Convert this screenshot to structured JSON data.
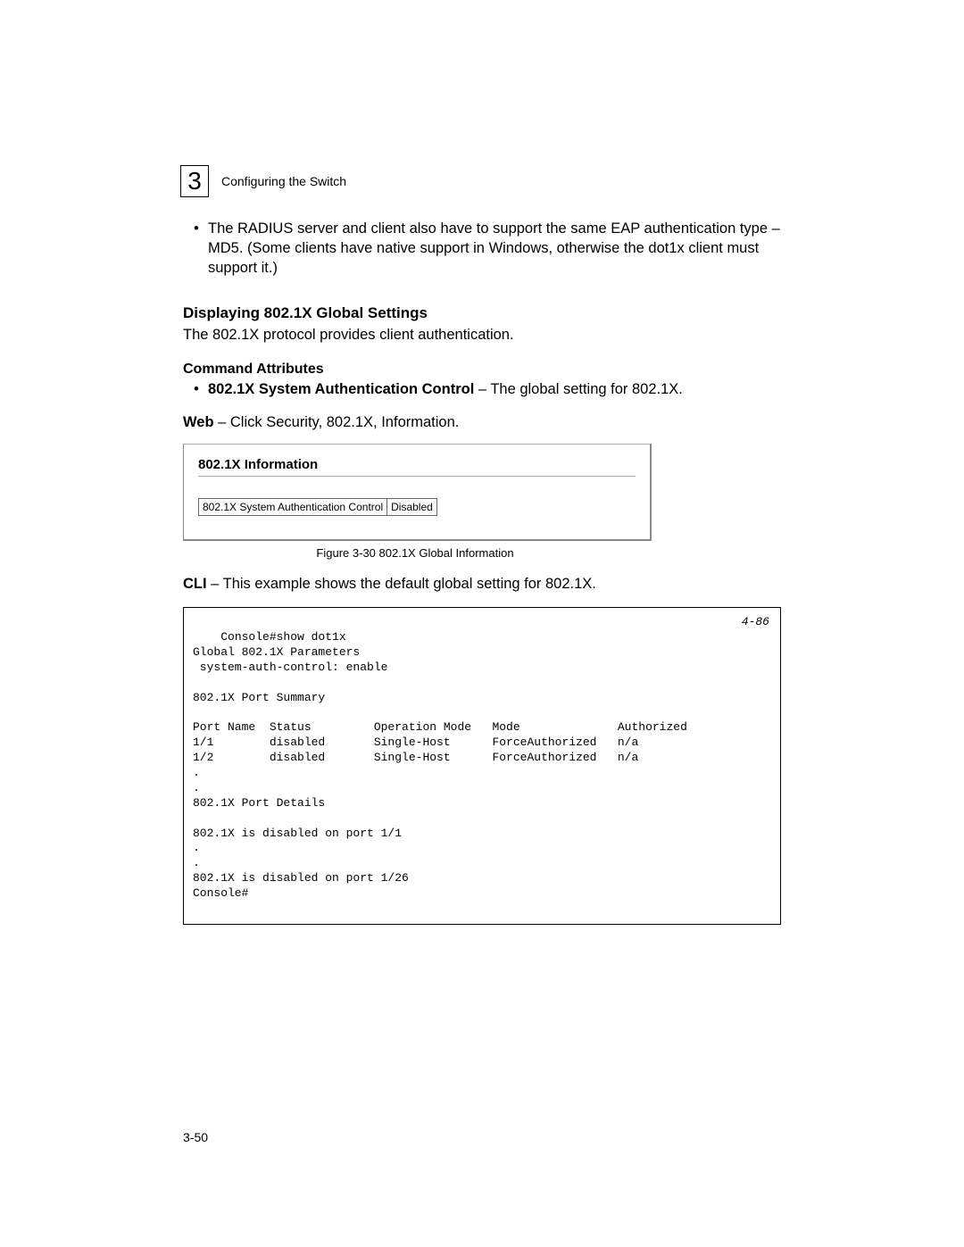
{
  "header": {
    "chapter_number": "3",
    "chapter_title": "Configuring the Switch"
  },
  "top_bullet": {
    "text": "The RADIUS server and client also have to support the same EAP authentication type – MD5. (Some clients have native support in Windows, otherwise the dot1x client must support it.)"
  },
  "section": {
    "heading": "Displaying 802.1X Global Settings",
    "intro": "The 802.1X protocol provides client authentication."
  },
  "attributes": {
    "heading": "Command Attributes",
    "bold_label": "802.1X System Authentication Control",
    "desc": " – The global setting for 802.1X."
  },
  "web": {
    "bold": "Web",
    "text": " – Click Security, 802.1X, Information."
  },
  "panel": {
    "title": "802.1X Information",
    "label": "802.1X System Authentication Control",
    "value": "Disabled"
  },
  "figure_caption": "Figure 3-30  802.1X Global Information",
  "cli": {
    "bold": "CLI",
    "intro": " – This example shows the default global setting for 802.1X.",
    "ref": "4-86",
    "body": "Console#show dot1x\nGlobal 802.1X Parameters\n system-auth-control: enable\n\n802.1X Port Summary\n\nPort Name  Status         Operation Mode   Mode              Authorized\n1/1        disabled       Single-Host      ForceAuthorized   n/a\n1/2        disabled       Single-Host      ForceAuthorized   n/a\n.\n.\n802.1X Port Details\n\n802.1X is disabled on port 1/1\n.\n.\n802.1X is disabled on port 1/26\nConsole#"
  },
  "page_number": "3-50"
}
